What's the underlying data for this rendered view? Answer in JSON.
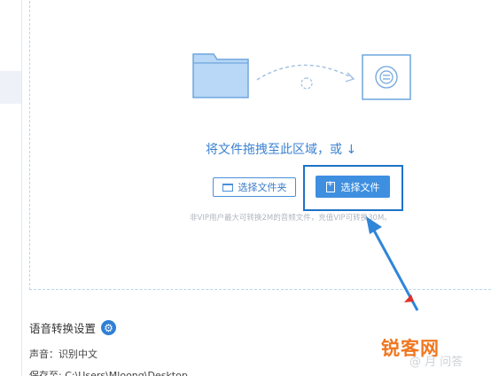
{
  "dropzone": {
    "instruction": "将文件拖拽至此区域，或 ↓",
    "select_folder_label": "选择文件夹",
    "select_file_label": "选择文件",
    "vip_note": "非VIP用户最大可转换2M的音频文件，充值VIP可转换30M。"
  },
  "settings": {
    "title": "语音转换设置",
    "voice_label": "声音：识别中文",
    "save_label": "保存至: C:\\Users\\Mloong\\Desktop"
  },
  "watermark": {
    "text": "锐客网",
    "sub": "@ 月 问答"
  },
  "colors": {
    "accent": "#3e8fe0",
    "highlight_border": "#1e73c8",
    "watermark": "#f0771f"
  }
}
